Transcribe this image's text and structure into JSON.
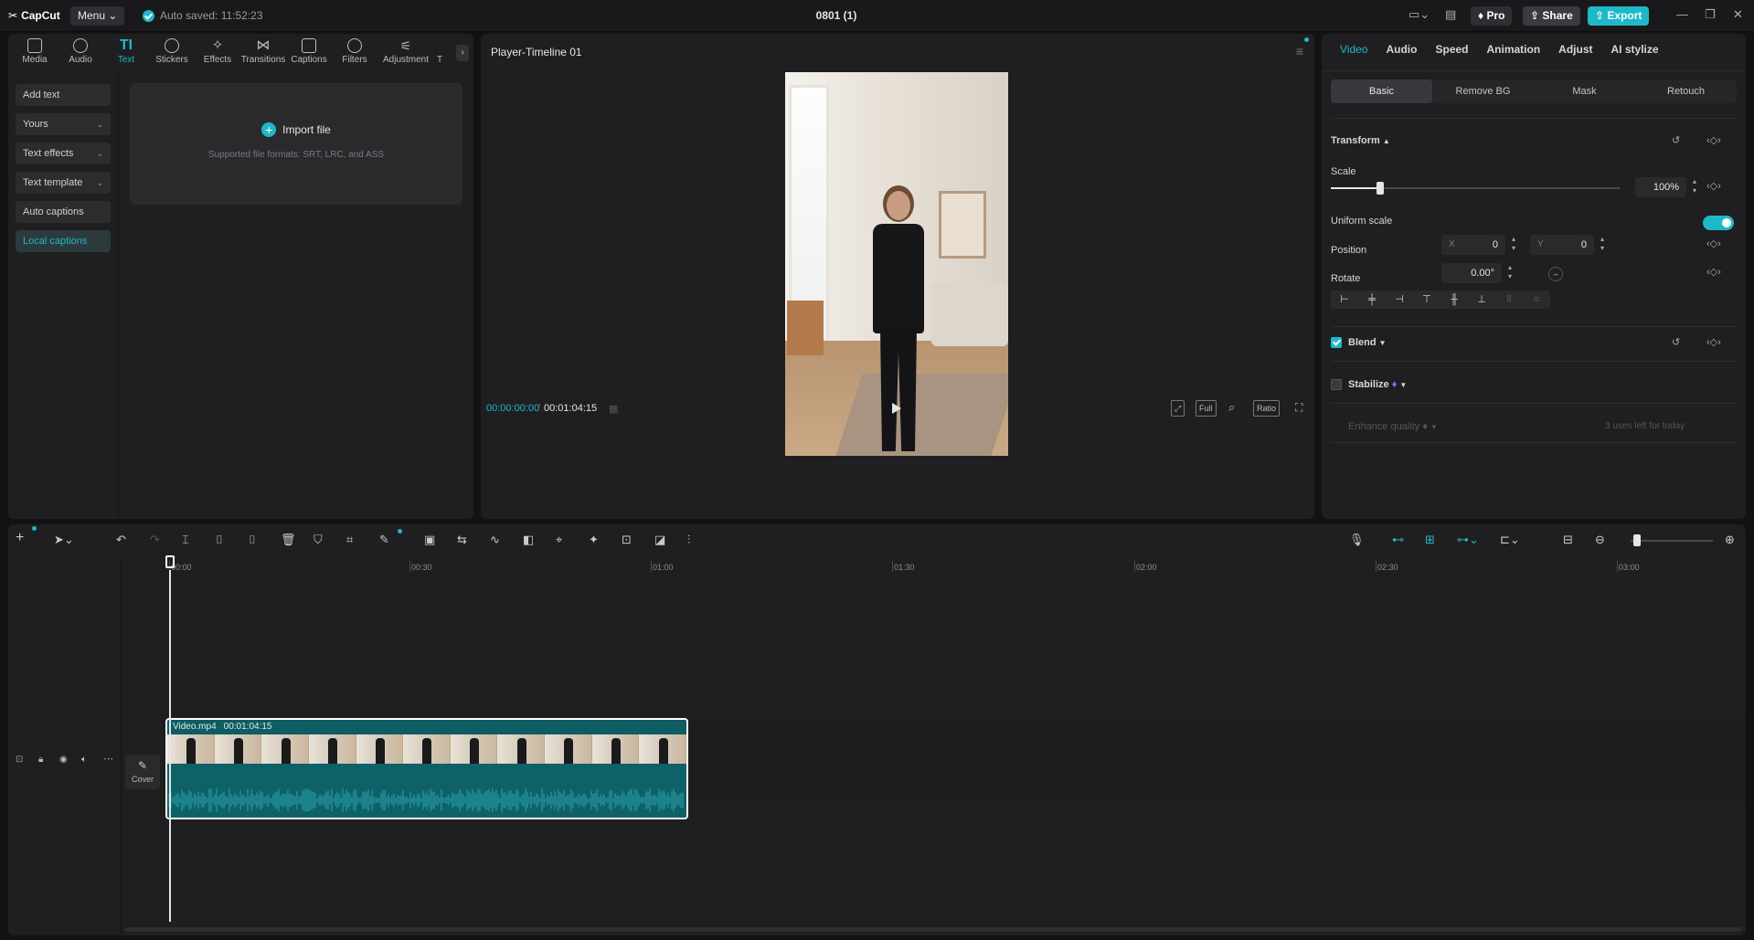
{
  "titlebar": {
    "logo": "CapCut",
    "menu_label": "Menu",
    "autosave_text": "Auto saved: 11:52:23",
    "project_title": "0801 (1)",
    "pro_label": "Pro",
    "share_label": "Share",
    "export_label": "Export"
  },
  "toolbar": {
    "items": [
      {
        "label": "Media",
        "icon": "media-icon"
      },
      {
        "label": "Audio",
        "icon": "audio-icon"
      },
      {
        "label": "Text",
        "icon": "text-icon",
        "active": true
      },
      {
        "label": "Stickers",
        "icon": "stickers-icon"
      },
      {
        "label": "Effects",
        "icon": "effects-icon"
      },
      {
        "label": "Transitions",
        "icon": "transitions-icon"
      },
      {
        "label": "Captions",
        "icon": "captions-icon"
      },
      {
        "label": "Filters",
        "icon": "filters-icon"
      },
      {
        "label": "Adjustment",
        "icon": "adjustment-icon"
      }
    ],
    "overflow_label": "T"
  },
  "text_panel": {
    "side_items": [
      {
        "label": "Add text"
      },
      {
        "label": "Yours",
        "has_chevron": true
      },
      {
        "label": "Text effects",
        "has_chevron": true
      },
      {
        "label": "Text template",
        "has_chevron": true
      },
      {
        "label": "Auto captions"
      },
      {
        "label": "Local captions",
        "active": true
      }
    ],
    "import_title": "Import file",
    "import_sub": "Supported file formats: SRT, LRC, and ASS"
  },
  "player": {
    "title": "Player-Timeline 01",
    "current_time": "00:00:00:00",
    "total_time": "00:01:04:15",
    "full_label": "Full",
    "ratio_label": "Ratio"
  },
  "properties": {
    "tabs": [
      "Video",
      "Audio",
      "Speed",
      "Animation",
      "Adjust",
      "AI stylize"
    ],
    "subtabs": [
      "Basic",
      "Remove BG",
      "Mask",
      "Retouch"
    ],
    "transform_label": "Transform",
    "scale_label": "Scale",
    "scale_value": "100%",
    "scale_fraction": 0.17,
    "uniform_scale_label": "Uniform scale",
    "uniform_scale_on": true,
    "position_label": "Position",
    "pos_x_axis": "X",
    "pos_x": "0",
    "pos_y_axis": "Y",
    "pos_y": "0",
    "rotate_label": "Rotate",
    "rotate_value": "0.00°",
    "blend_label": "Blend",
    "blend_checked": true,
    "stabilize_label": "Stabilize",
    "stabilize_checked": false,
    "enhance_label": "Enhance quality",
    "enhance_note": "3 uses left for today"
  },
  "timeline": {
    "ruler_labels": [
      "00:00",
      "00:30",
      "01:00",
      "01:30",
      "02:00",
      "02:30",
      "03:00"
    ],
    "clip_name": "Video.mp4",
    "clip_duration": "00:01:04:15",
    "cover_label": "Cover"
  },
  "colors": {
    "accent": "#1fb8c8",
    "background": "#121214",
    "panel": "#1f1f21"
  }
}
